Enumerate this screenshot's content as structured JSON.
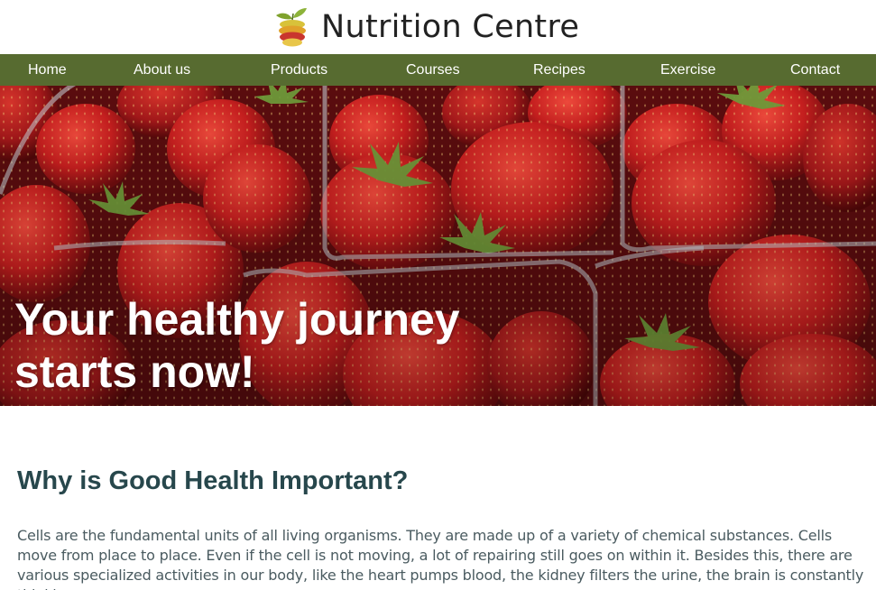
{
  "header": {
    "logo_text": "Nutrition Centre",
    "logo_icon": "fruit-stack-logo-icon"
  },
  "nav": {
    "items": [
      {
        "label": "Home"
      },
      {
        "label": "About us"
      },
      {
        "label": "Products"
      },
      {
        "label": "Courses"
      },
      {
        "label": "Recipes"
      },
      {
        "label": "Exercise"
      },
      {
        "label": "Contact"
      }
    ]
  },
  "hero": {
    "title_line1": "Your healthy journey",
    "title_line2": "starts now!",
    "image": "strawberries-in-punnets-photo"
  },
  "main": {
    "heading": "Why is Good Health Important?",
    "paragraph": "Cells are the fundamental units of all living organisms. They are made up of a variety of chemical substances. Cells move from place to place. Even if the cell is not moving, a lot of repairing still goes on within it. Besides this, there are various specialized activities in our body, like the heart pumps blood, the kidney filters the urine, the brain is constantly thinking,"
  },
  "colors": {
    "nav_bg": "#576b30",
    "heading": "#27474c",
    "body_text": "#4a5b60"
  }
}
